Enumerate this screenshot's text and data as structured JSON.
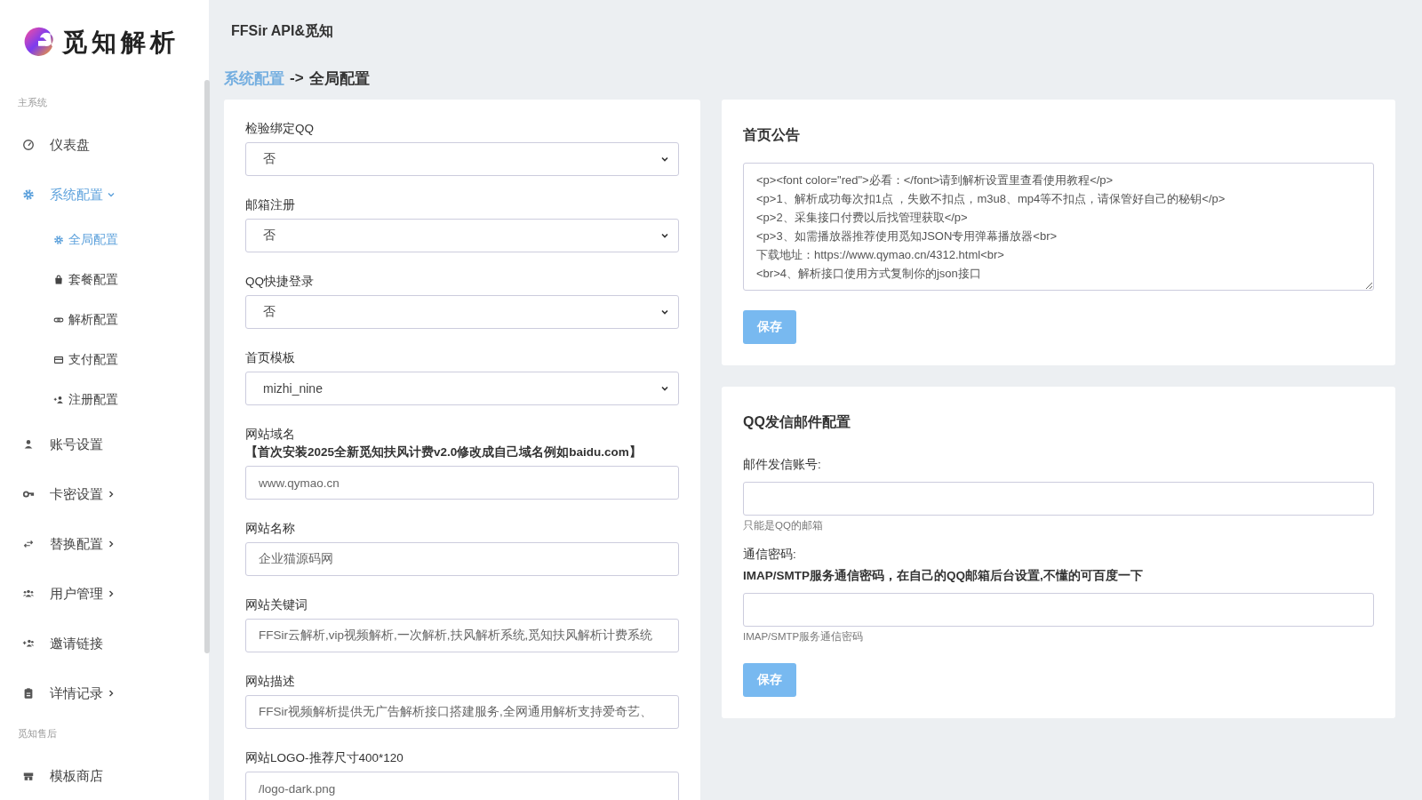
{
  "logo": {
    "text": "觅知解析"
  },
  "header": {
    "title": "FFSir API&觅知"
  },
  "breadcrumb": {
    "parent": "系统配置",
    "separator": "->",
    "current": "全局配置"
  },
  "sidebar": {
    "sections": [
      {
        "label": "主系统",
        "items": [
          {
            "label": "仪表盘",
            "selected": false
          },
          {
            "label": "系统配置",
            "selected": true,
            "expanded": true,
            "children": [
              {
                "label": "全局配置",
                "selected": true
              },
              {
                "label": "套餐配置",
                "selected": false
              },
              {
                "label": "解析配置",
                "selected": false
              },
              {
                "label": "支付配置",
                "selected": false
              },
              {
                "label": "注册配置",
                "selected": false
              }
            ]
          },
          {
            "label": "账号设置",
            "selected": false
          },
          {
            "label": "卡密设置",
            "selected": false,
            "expanded": false
          },
          {
            "label": "替换配置",
            "selected": false,
            "expanded": false
          },
          {
            "label": "用户管理",
            "selected": false,
            "expanded": false
          },
          {
            "label": "邀请链接",
            "selected": false
          },
          {
            "label": "详情记录",
            "selected": false,
            "expanded": false
          }
        ]
      },
      {
        "label": "觅知售后",
        "items": [
          {
            "label": "模板商店",
            "selected": false
          }
        ]
      }
    ]
  },
  "global_form": {
    "fields": [
      {
        "kind": "select",
        "label": "检验绑定QQ",
        "value": "否"
      },
      {
        "kind": "select",
        "label": "邮箱注册",
        "value": "否"
      },
      {
        "kind": "select",
        "label": "QQ快捷登录",
        "value": "否"
      },
      {
        "kind": "select",
        "label": "首页模板",
        "value": "mizhi_nine"
      },
      {
        "kind": "input",
        "label": "网站域名",
        "note": "【首次安装2025全新觅知扶风计费v2.0修改成自己域名例如baidu.com】",
        "value": "www.qymao.cn"
      },
      {
        "kind": "input",
        "label": "网站名称",
        "value": "企业猫源码网"
      },
      {
        "kind": "input",
        "label": "网站关键词",
        "value": "FFSir云解析,vip视频解析,一次解析,扶风解析系统,觅知扶风解析计费系统"
      },
      {
        "kind": "input",
        "label": "网站描述",
        "value": "FFSir视频解析提供无广告解析接口搭建服务,全网通用解析支持爱奇艺、"
      },
      {
        "kind": "input",
        "label": "网站LOGO-推荐尺寸400*120",
        "value": "/logo-dark.png"
      }
    ]
  },
  "notice_card": {
    "title": "首页公告",
    "lines": [
      "<p><font color=\"red\">必看：</font>请到解析设置里查看使用教程</p>",
      "<p>1、解析成功每次扣1点 ，失败不扣点，m3u8、mp4等不扣点，请保管好自己的秘钥</p>",
      "<p>2、采集接口付费以后找管理获取</p>",
      "<p>3、如需播放器推荐使用觅知JSON专用弹幕播放器<br>",
      "下载地址：https://www.qymao.cn/4312.html<br>",
      "<br>4、解析接口使用方式复制你的json接口"
    ],
    "button": "保存"
  },
  "mail_card": {
    "title": "QQ发信邮件配置",
    "fields": [
      {
        "label": "邮件发信账号:",
        "help": "只能是QQ的邮箱"
      },
      {
        "label": "通信密码:",
        "note": "IMAP/SMTP服务通信密码，在自己的QQ邮箱后台设置,不懂的可百度一下",
        "help": "IMAP/SMTP服务通信密码"
      }
    ],
    "button": "保存"
  }
}
